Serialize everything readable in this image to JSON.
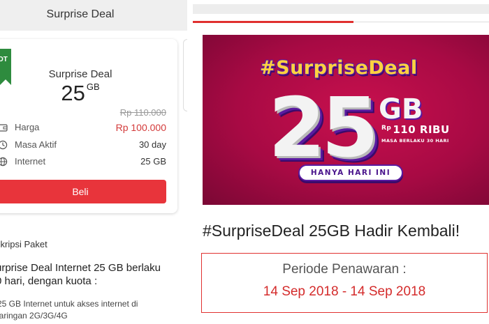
{
  "left_panel": {
    "header_title": "Surprise Deal",
    "badge": "OT",
    "package": {
      "name": "Surprise Deal",
      "size_value": "25",
      "size_unit": "GB",
      "old_price": "Rp 110.000"
    },
    "details": [
      {
        "icon": "wallet-icon",
        "label": "Harga",
        "value": "Rp  100.000"
      },
      {
        "icon": "clock-icon",
        "label": "Masa Aktif",
        "value": "30 day"
      },
      {
        "icon": "globe-icon",
        "label": "Internet",
        "value": "25 GB"
      }
    ],
    "buy_label": "Beli",
    "description_title": "skripsi Paket",
    "description_heading": "urprise Deal Internet 25 GB berlaku\n0 hari, dengan kuota :",
    "description_bullet": "25 GB Internet untuk akses internet di\njaringan 2G/3G/4G"
  },
  "right_panel": {
    "banner": {
      "hashtag": "#SurpriseDeal",
      "number": "25",
      "unit": "GB",
      "price_prefix": "Rp",
      "price": "110 RIBU",
      "validity": "MASA BERLAKU 30 HARI",
      "pill": "HANYA HARI INI"
    },
    "headline": "#SurpriseDeal 25GB Hadir Kembali!",
    "promo_label": "Periode Penawaran :",
    "promo_dates": "14 Sep 2018 - 14 Sep 2018"
  },
  "colors": {
    "accent_red": "#e8343b",
    "badge_green": "#2e8b3e",
    "banner_magenta": "#b80c48"
  }
}
